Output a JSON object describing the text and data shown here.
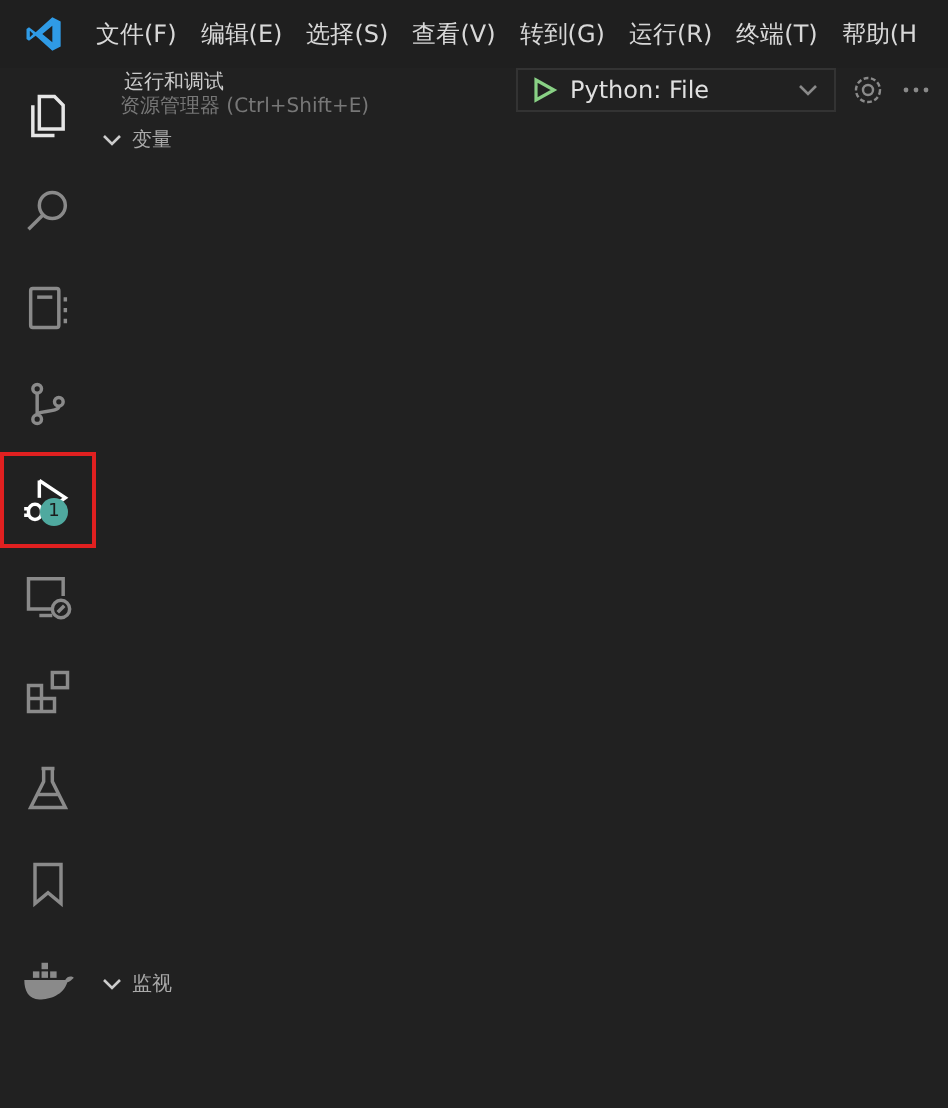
{
  "menu_bar": {
    "items": [
      "文件(F)",
      "编辑(E)",
      "选择(S)",
      "查看(V)",
      "转到(G)",
      "运行(R)",
      "终端(T)",
      "帮助(H"
    ]
  },
  "activity_bar": {
    "items": [
      {
        "kind": "files",
        "selected": false
      },
      {
        "kind": "search",
        "selected": false
      },
      {
        "kind": "notebook",
        "selected": false
      },
      {
        "kind": "source-control",
        "selected": false
      },
      {
        "kind": "run-debug",
        "selected": true,
        "badge": "1"
      },
      {
        "kind": "remote",
        "selected": false
      },
      {
        "kind": "extensions",
        "selected": false
      },
      {
        "kind": "testing",
        "selected": false
      },
      {
        "kind": "bookmarks",
        "selected": false
      },
      {
        "kind": "docker",
        "selected": false
      }
    ]
  },
  "sidebar": {
    "title": "运行和调试",
    "tooltip": "资源管理器 (Ctrl+Shift+E)",
    "launch_config": "Python: File",
    "sections": [
      {
        "title": "变量",
        "expanded": true
      },
      {
        "title": "监视",
        "expanded": true
      }
    ]
  }
}
